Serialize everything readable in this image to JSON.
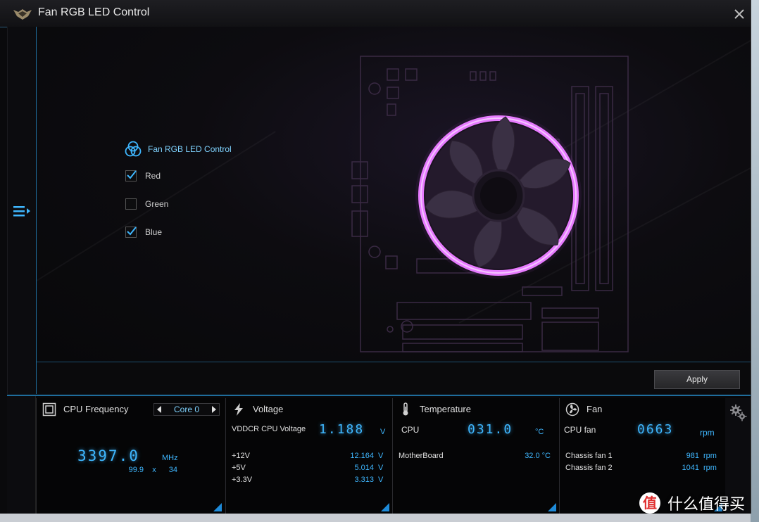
{
  "window": {
    "title": "Fan RGB LED Control"
  },
  "control": {
    "title": "Fan RGB LED Control",
    "options": [
      {
        "label": "Red",
        "checked": true
      },
      {
        "label": "Green",
        "checked": false
      },
      {
        "label": "Blue",
        "checked": true
      }
    ]
  },
  "actions": {
    "apply_label": "Apply"
  },
  "cpu_frequency": {
    "title": "CPU Frequency",
    "core_selector": "Core 0",
    "value": "3397.0",
    "unit": "MHz",
    "base": "99.9",
    "multiplier_sep": "x",
    "ratio": "34"
  },
  "voltage": {
    "title": "Voltage",
    "main_label": "VDDCR CPU Voltage",
    "main_value": "1.188",
    "main_unit": "V",
    "rows": [
      {
        "label": "+12V",
        "value": "12.164",
        "unit": "V"
      },
      {
        "label": "+5V",
        "value": "5.014",
        "unit": "V"
      },
      {
        "label": "+3.3V",
        "value": "3.313",
        "unit": "V"
      }
    ]
  },
  "temperature": {
    "title": "Temperature",
    "main_label": "CPU",
    "main_value": "031.0",
    "main_unit": "°C",
    "rows": [
      {
        "label": "MotherBoard",
        "value": "32.0 °C"
      }
    ]
  },
  "fan": {
    "title": "Fan",
    "main_label": "CPU fan",
    "main_value": "0663",
    "main_unit": "rpm",
    "rows": [
      {
        "label": "Chassis fan 1",
        "value": "981",
        "unit": "rpm"
      },
      {
        "label": "Chassis fan 2",
        "value": "1041",
        "unit": "rpm"
      }
    ]
  },
  "watermark": {
    "badge": "值",
    "text": "什么值得买"
  },
  "colors": {
    "accent": "#3fb7ff",
    "ring": "#d55cff",
    "border": "#1f6d9c"
  },
  "icons": {
    "logo": "tuf-logo-icon",
    "close": "close-icon",
    "menu": "menu-icon",
    "rgb": "rgb-circles-icon",
    "cpu": "cpu-chip-icon",
    "voltage": "lightning-icon",
    "temperature": "thermometer-icon",
    "fan": "fan-icon",
    "settings": "gear-icon"
  }
}
